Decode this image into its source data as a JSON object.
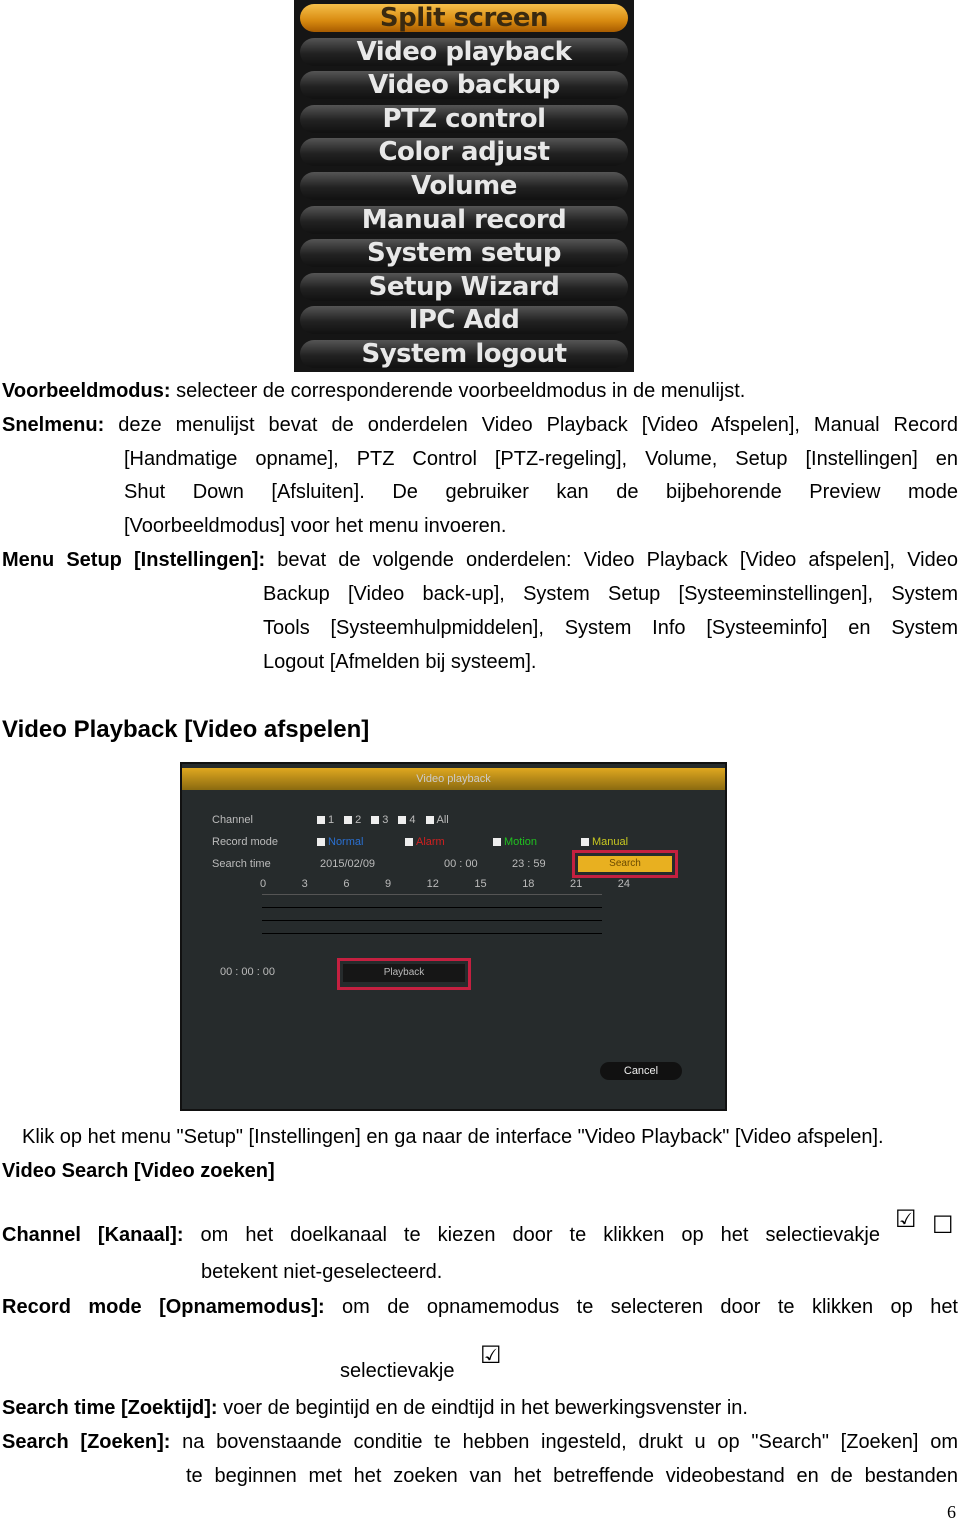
{
  "menu": {
    "items": [
      "Split screen",
      "Video playback",
      "Video backup",
      "PTZ control",
      "Color adjust",
      "Volume",
      "Manual record",
      "System setup",
      "Setup Wizard",
      "IPC Add",
      "System logout"
    ],
    "active": 0
  },
  "p1": {
    "label": "Voorbeeldmodus:",
    "text": " selecteer de corresponderende voorbeeldmodus in de menulijst."
  },
  "p2": {
    "label": "Snelmenu:",
    "lines": [
      " deze menulijst bevat de onderdelen Video Playback [Video Afspelen], Manual Record",
      "[Handmatige opname], PTZ Control [PTZ-regeling], Volume, Setup [Instellingen] en",
      "Shut Down [Afsluiten]. De gebruiker kan de bijbehorende Preview mode",
      "[Voorbeeldmodus] voor het menu invoeren."
    ]
  },
  "p3": {
    "label": "Menu Setup [Instellingen]:",
    "lines": [
      " bevat de volgende onderdelen: Video Playback [Video afspelen], Video",
      "Backup [Video back-up], System Setup [Systeeminstellingen], System",
      "Tools [Systeemhulpmiddelen], System Info [Systeeminfo] en System",
      "Logout [Afmelden bij systeem]."
    ]
  },
  "heading": "Video Playback [Video afspelen]",
  "dialog": {
    "title": "Video playback",
    "channel_label": "Channel",
    "channels": [
      "1",
      "2",
      "3",
      "4",
      "All"
    ],
    "record_mode_label": "Record mode",
    "modes": [
      {
        "label": "Normal",
        "color": "#2a6fd0"
      },
      {
        "label": "Alarm",
        "color": "#d02020"
      },
      {
        "label": "Motion",
        "color": "#20c020"
      },
      {
        "label": "Manual",
        "color": "#c8c820"
      }
    ],
    "search_time_label": "Search time",
    "date": "2015/02/09",
    "start": "00 : 00",
    "end": "23 : 59",
    "search_btn": "Search",
    "hours": [
      "0",
      "3",
      "6",
      "9",
      "12",
      "15",
      "18",
      "21",
      "24"
    ],
    "time": "00 : 00 : 00",
    "playback_btn": "Playback",
    "cancel_btn": "Cancel"
  },
  "caption": "Klik op het menu \"Setup\" [Instellingen] en ga naar de interface \"Video Playback\" [Video afspelen].",
  "subheading": "Video Search [Video zoeken]",
  "p4": {
    "label": "Channel [Kanaal]:",
    "lines": [
      " om het doelkanaal te kiezen door te klikken op het selectievakje",
      "betekent niet-geselecteerd."
    ]
  },
  "p5": {
    "label": "Record mode [Opnamemodus]:",
    "lines": [
      " om de opnamemodus te selecteren door te klikken op het",
      "selectievakje"
    ]
  },
  "p6": {
    "label": "Search time [Zoektijd]:",
    "text": " voer de begintijd en de eindtijd in het bewerkingsvenster in."
  },
  "p7": {
    "label": "Search [Zoeken]:",
    "lines": [
      " na bovenstaande conditie te hebben ingesteld, drukt u op \"Search\" [Zoeken] om",
      "te beginnen met het zoeken van het betreffende videobestand en de bestanden"
    ]
  },
  "icons": {
    "checked": "☑",
    "unchecked": "☐"
  },
  "page_number": "6"
}
